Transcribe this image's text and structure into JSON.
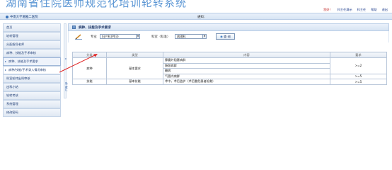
{
  "app": {
    "banner_title": "湖南省住院医师规范化培训轮转系统",
    "top_links": [
      "您好！",
      "科主任满示",
      "科主任",
      "帮助",
      "退出"
    ],
    "hospital_name": "中南大学湘雅二医院",
    "notice_label": "通知："
  },
  "sidebar": {
    "items": [
      {
        "label": "首页"
      },
      {
        "label": "轮转管理"
      },
      {
        "label": "分配指导老师"
      },
      {
        "label": "病种、技能及手术审核"
      },
      {
        "label": "病种、技能及手术要求"
      },
      {
        "label": "病种/技能/手术录入情况审核"
      },
      {
        "label": "科室轮转出科审核"
      },
      {
        "label": "出科小结"
      },
      {
        "label": "轮转考核"
      },
      {
        "label": "系统管理"
      },
      {
        "label": "修改密码"
      }
    ],
    "vertical_glyphs": "隐藏栏"
  },
  "main": {
    "panel_title": "病种、技能及手术要求",
    "filter": {
      "major_label": "专业",
      "major_value": "妇产科(P03)",
      "dept_label": "科室（标准）",
      "dept_value": "病理科",
      "query_label": "查 询"
    },
    "table": {
      "headers": [
        "分类",
        "类型",
        "内容",
        "要求"
      ],
      "rows": [
        {
          "category": "病种",
          "type": "基本要求",
          "content": "腺囊外阻塞病群",
          "req": ""
        },
        {
          "category": "",
          "type": "",
          "content": "肠胀病群",
          "req": ">=2"
        },
        {
          "category": "",
          "type": "",
          "content": "糖病",
          "req": ""
        },
        {
          "category": "",
          "type": "",
          "content": "气管内病群",
          "req": ">=5"
        },
        {
          "category": "技能",
          "type": "基本技能",
          "content": "术中，术后监护（术后重危患者抢救）",
          "req": ">=5"
        }
      ]
    }
  }
}
